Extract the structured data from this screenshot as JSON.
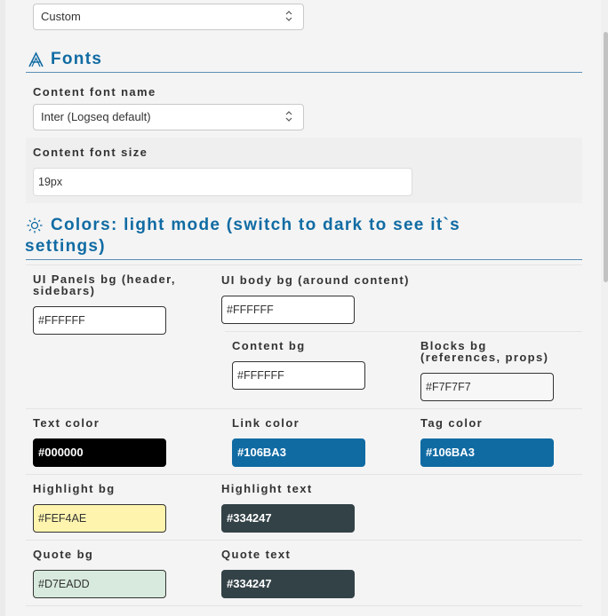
{
  "top_select": {
    "value": "Custom"
  },
  "fonts": {
    "title": "Fonts",
    "name_label": "Content font name",
    "name_value": "Inter (Logseq default)",
    "size_label": "Content font size",
    "size_value": "19px"
  },
  "colors": {
    "title_line1": "Colors: light mode (switch to dark to see it`s",
    "title_line2": "settings)",
    "ui_panels_bg": {
      "label_line1": "UI Panels bg (header,",
      "label_line2": "sidebars)",
      "value": "#FFFFFF"
    },
    "ui_body_bg": {
      "label": "UI body bg (around content)",
      "value": "#FFFFFF"
    },
    "content_bg": {
      "label": "Content bg",
      "value": "#FFFFFF"
    },
    "blocks_bg": {
      "label_line1": "Blocks bg",
      "label_line2": "(references, props)",
      "value": "#F7F7F7"
    },
    "text_color": {
      "label": "Text color",
      "value": "#000000",
      "color": "#000000"
    },
    "link_color": {
      "label": "Link color",
      "value": "#106BA3",
      "color": "#106BA3"
    },
    "tag_color": {
      "label": "Tag color",
      "value": "#106BA3",
      "color": "#106BA3"
    },
    "highlight_bg": {
      "label": "Highlight bg",
      "value": "#FEF4AE",
      "color": "#FEF4AE"
    },
    "highlight_text": {
      "label": "Highlight text",
      "value": "#334247",
      "color": "#334247"
    },
    "quote_bg": {
      "label": "Quote bg",
      "value": "#D7EADD",
      "color": "#D7EADD"
    },
    "quote_text": {
      "label": "Quote text",
      "value": "#334247",
      "color": "#334247"
    }
  },
  "icons": {
    "fonts": "font-icon",
    "colors": "sun-icon",
    "select": "chevron-updown-icon"
  }
}
